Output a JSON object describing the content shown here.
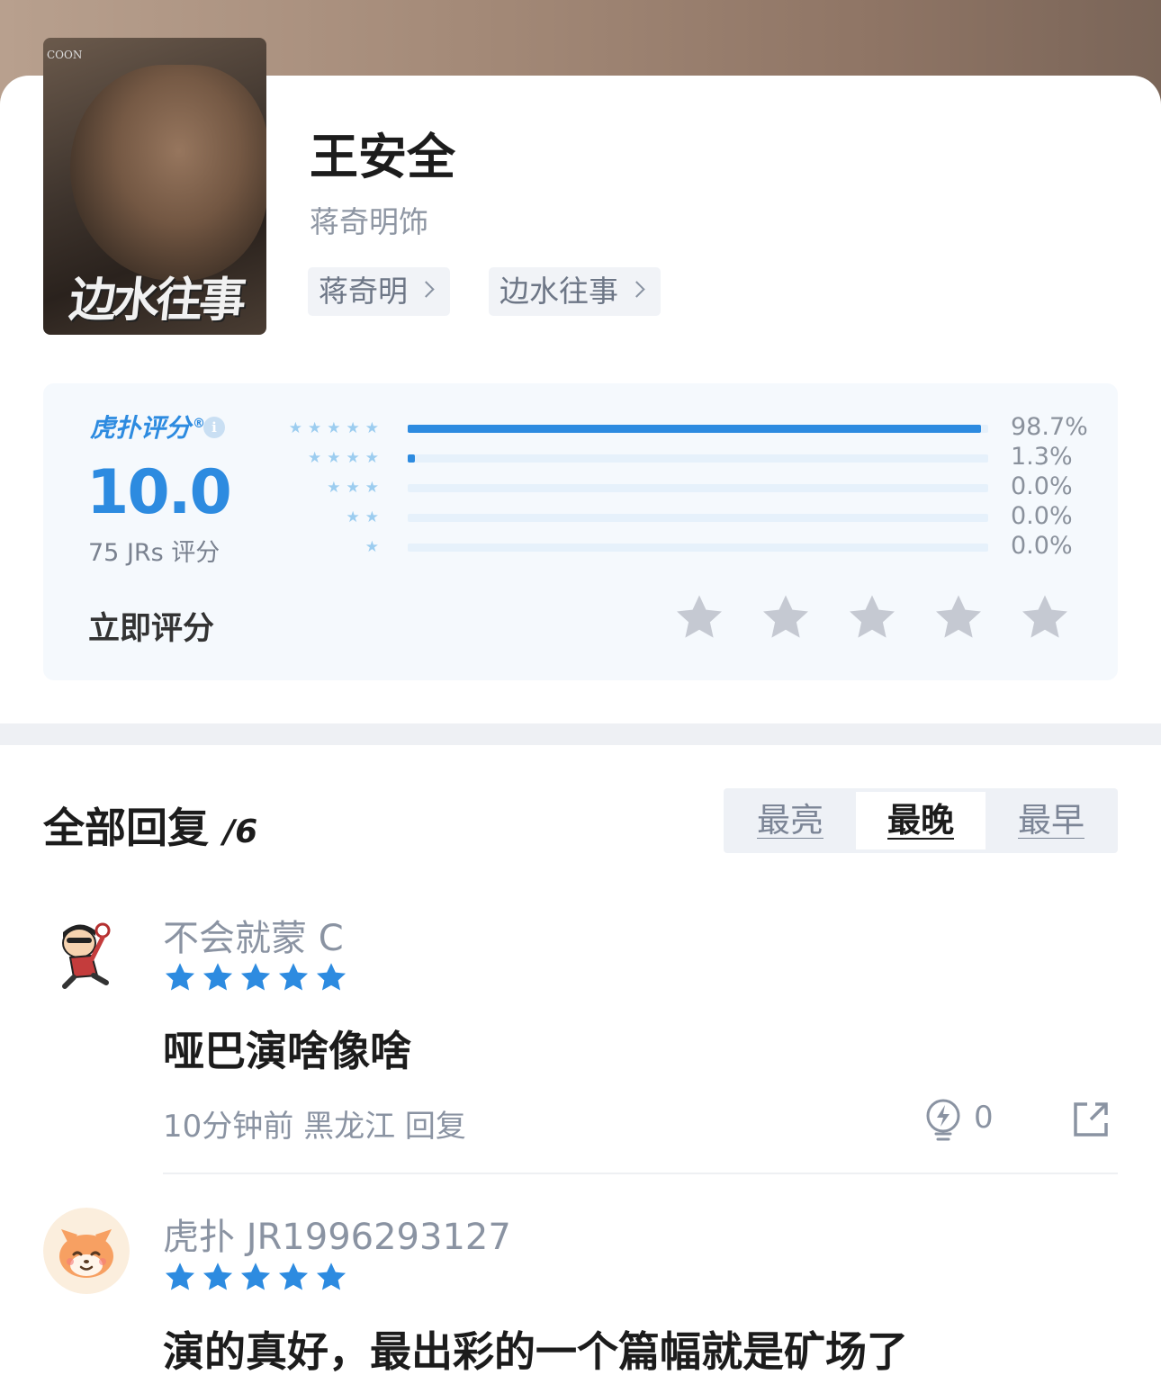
{
  "character": {
    "name": "王安全",
    "role": "蒋奇明饰",
    "tags": [
      "蒋奇明",
      "边水往事"
    ],
    "poster_title": "边水往事",
    "poster_small": "COON"
  },
  "rating": {
    "brand": "虎扑评分",
    "registered": "®",
    "score": "10.0",
    "count_label": "75 JRs 评分",
    "distribution": [
      {
        "stars": "★★★★★",
        "percent_label": "98.7%",
        "fraction": 0.987
      },
      {
        "stars": "★★★★",
        "percent_label": "1.3%",
        "fraction": 0.013
      },
      {
        "stars": "★★★",
        "percent_label": "0.0%",
        "fraction": 0.0
      },
      {
        "stars": "★★",
        "percent_label": "0.0%",
        "fraction": 0.0
      },
      {
        "stars": "★",
        "percent_label": "0.0%",
        "fraction": 0.0
      }
    ],
    "rate_now_label": "立即评分",
    "rate_now_stars": 5
  },
  "replies": {
    "title": "全部回复",
    "count": "/6",
    "sort_tabs": [
      "最亮",
      "最晚",
      "最早"
    ],
    "active_sort": "最晚",
    "items": [
      {
        "username": "不会就蒙 C",
        "stars": 5,
        "content": "哑巴演啥像啥",
        "meta": "10分钟前  黑龙江  回复",
        "likes": "0"
      },
      {
        "username": "虎扑 JR1996293127",
        "stars": 5,
        "content": "演的真好，最出彩的一个篇幅就是矿场了"
      }
    ]
  },
  "colors": {
    "accent": "#2d8be0",
    "muted_text": "#8a93a2",
    "star_inactive": "#c5c9d2",
    "track": "#e6f1fb"
  }
}
